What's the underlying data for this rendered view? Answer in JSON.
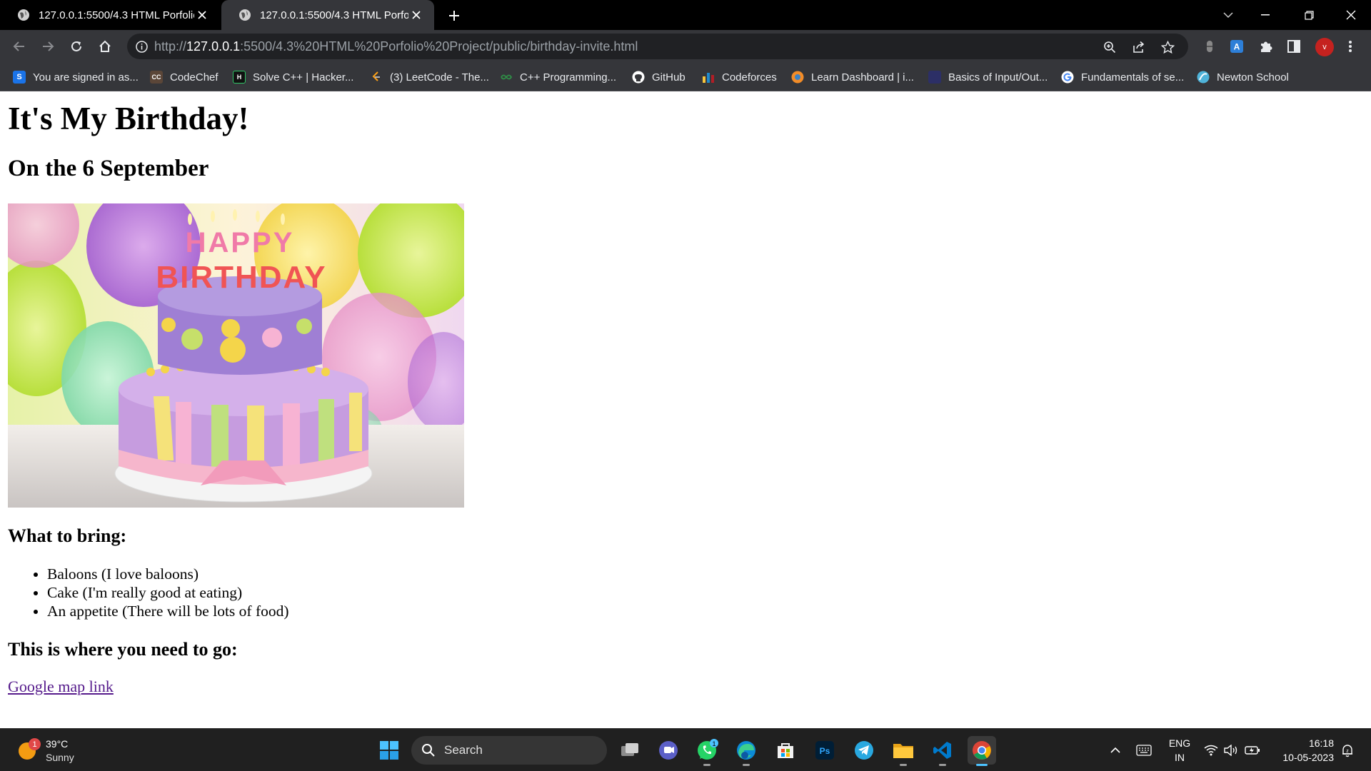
{
  "browser": {
    "tabs": [
      {
        "title": "127.0.0.1:5500/4.3 HTML Porfolio Project",
        "active": false
      },
      {
        "title": "127.0.0.1:5500/4.3 HTML Porfolio Project",
        "active": true
      }
    ],
    "url": {
      "scheme": "http://",
      "host": "127.0.0.1",
      "rest": ":5500/4.3%20HTML%20Porfolio%20Project/public/birthday-invite.html"
    },
    "profile_initial": "v"
  },
  "bookmarks": [
    {
      "label": "You are signed in as...",
      "icon": "s-icon",
      "color": "#1a73e8",
      "glyph": "S"
    },
    {
      "label": "CodeChef",
      "icon": "codechef-icon",
      "color": "#5b4638",
      "glyph": "CC"
    },
    {
      "label": "Solve C++ | Hacker...",
      "icon": "hackerrank-icon",
      "color": "#1a1a1a",
      "glyph": "H"
    },
    {
      "label": "(3) LeetCode - The...",
      "icon": "leetcode-icon",
      "color": "#35363a",
      "glyph": "⟨"
    },
    {
      "label": "C++ Programming...",
      "icon": "gfg-icon",
      "color": "#35363a",
      "glyph": "∞"
    },
    {
      "label": "GitHub",
      "icon": "github-icon",
      "color": "#35363a",
      "glyph": "●"
    },
    {
      "label": "Codeforces",
      "icon": "codeforces-icon",
      "color": "#35363a",
      "glyph": "▮"
    },
    {
      "label": "Learn Dashboard | i...",
      "icon": "learn-icon",
      "color": "#f28c28",
      "glyph": ""
    },
    {
      "label": "Basics of Input/Out...",
      "icon": "hackerearth-icon",
      "color": "#2c2f66",
      "glyph": ""
    },
    {
      "label": "Fundamentals of se...",
      "icon": "google-icon",
      "color": "#ffffff",
      "glyph": "G"
    },
    {
      "label": "Newton School",
      "icon": "newton-icon",
      "color": "#4fb3d9",
      "glyph": ""
    }
  ],
  "page": {
    "title": "It's My Birthday!",
    "subtitle": "On the 6 September",
    "image_text": "HAPPY BIRTHDAY",
    "bring_heading": "What to bring:",
    "bring_items": [
      "Baloons (I love baloons)",
      "Cake (I'm really good at eating)",
      "An appetite (There will be lots of food)"
    ],
    "go_heading": "This is where you need to go:",
    "map_link": "Google map link"
  },
  "taskbar": {
    "weather_temp": "39°C",
    "weather_cond": "Sunny",
    "weather_badge": "1",
    "search_label": "Search",
    "whatsapp_badge": "1",
    "lang_1": "ENG",
    "lang_2": "IN",
    "time": "16:18",
    "date": "10-05-2023"
  },
  "colors": {
    "tab_bg": "#000000",
    "toolbar_bg": "#35363a",
    "omnibox_bg": "#202124",
    "link_visited": "#551a8b",
    "taskbar_bg": "#202020",
    "accent": "#4cc2ff"
  }
}
